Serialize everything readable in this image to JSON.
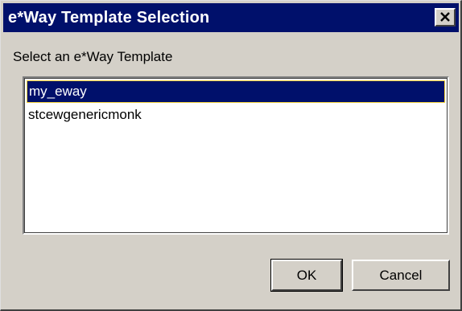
{
  "window": {
    "title": "e*Way Template Selection",
    "close_icon": "close-icon",
    "titlebar_color": "#00106b"
  },
  "prompt": "Select an e*Way Template",
  "templates": [
    {
      "label": "my_eway",
      "selected": true
    },
    {
      "label": "stcewgenericmonk",
      "selected": false
    }
  ],
  "buttons": {
    "ok_label": "OK",
    "cancel_label": "Cancel"
  },
  "colors": {
    "dialog_face": "#d4d0c8",
    "selection_bg": "#00106b",
    "focus_border": "#f2d13c"
  }
}
